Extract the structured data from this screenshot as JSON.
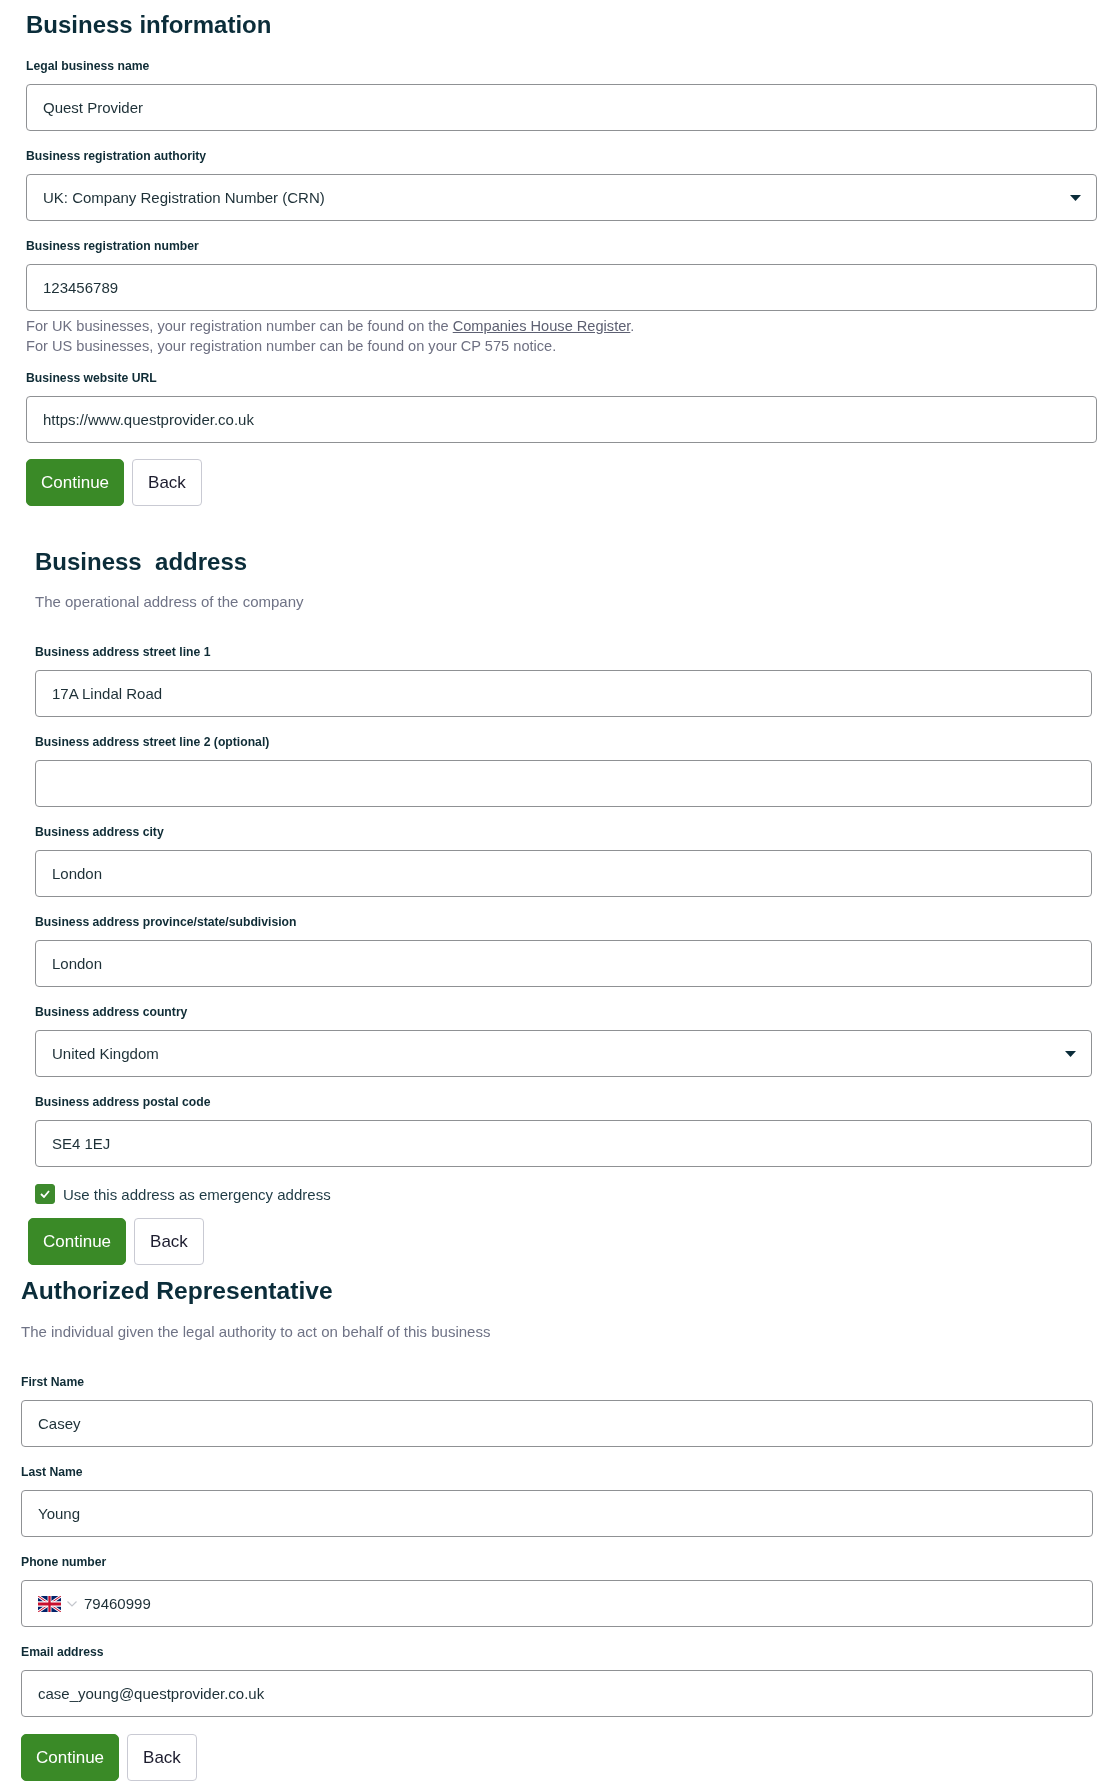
{
  "sections": [
    {
      "title": "Business information",
      "fields": [
        {
          "kind": "text",
          "label": "Legal business name",
          "value": "Quest Provider"
        },
        {
          "kind": "select",
          "label": "Business registration authority",
          "value": "UK: Company Registration Number (CRN)"
        },
        {
          "kind": "text",
          "label": "Business registration number",
          "value": "123456789",
          "help": [
            {
              "text": "For UK businesses, your registration number can be found on the ",
              "link": "Companies House Register",
              "after": "."
            },
            {
              "text": "For US businesses, your registration number can be found on your CP 575 notice."
            }
          ]
        },
        {
          "kind": "text",
          "label": "Business website URL",
          "value": "https://www.questprovider.co.uk"
        }
      ],
      "buttons": [
        {
          "kind": "primary",
          "label": "Continue"
        },
        {
          "kind": "secondary",
          "label": "Back"
        }
      ]
    },
    {
      "title": "Business  address",
      "description": "The operational address of the company",
      "fields": [
        {
          "kind": "text",
          "label": "Business address street line 1",
          "value": "17A Lindal Road"
        },
        {
          "kind": "text",
          "label": "Business address street line 2 (optional)"
        },
        {
          "kind": "text",
          "label": "Business address city",
          "value": "London"
        },
        {
          "kind": "text",
          "label": "Business address province/state/subdivision",
          "value": "London"
        },
        {
          "kind": "select",
          "label": "Business address country",
          "value": "United Kingdom"
        },
        {
          "kind": "text",
          "label": "Business address postal code",
          "value": "SE4 1EJ"
        }
      ],
      "checkbox": {
        "label": "Use this address as emergency address",
        "checked": true
      },
      "buttons": [
        {
          "kind": "primary",
          "label": "Continue"
        },
        {
          "kind": "secondary",
          "label": "Back"
        }
      ]
    },
    {
      "title": "Authorized Representative",
      "description": "The individual given the legal authority to act on behalf of this business",
      "fields": [
        {
          "kind": "text",
          "label": "First Name",
          "value": "Casey"
        },
        {
          "kind": "text",
          "label": "Last Name",
          "value": "Young"
        },
        {
          "kind": "phone",
          "label": "Phone number",
          "value": "79460999"
        },
        {
          "kind": "text",
          "label": "Email address",
          "value": "case_young@questprovider.co.uk"
        }
      ],
      "buttons": [
        {
          "kind": "primary",
          "label": "Continue"
        },
        {
          "kind": "secondary",
          "label": "Back"
        }
      ]
    }
  ]
}
